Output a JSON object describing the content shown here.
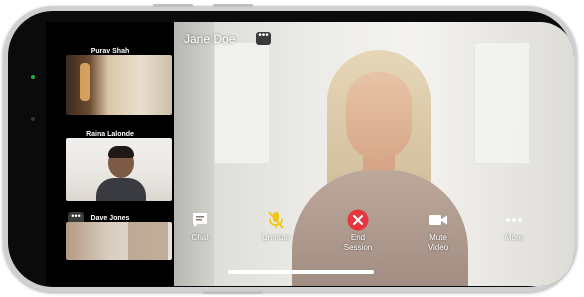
{
  "call": {
    "caller_name": "Jane Doe",
    "participants": [
      {
        "name": "Purav Shah"
      },
      {
        "name": "Raina Lalonde"
      },
      {
        "name": "Dave Jones"
      }
    ]
  },
  "controls": {
    "chat": "Chat",
    "unmute": "Unmute",
    "end_session": "End\nSession",
    "mute_video": "Mute\nVideo",
    "more": "More"
  },
  "glyphs": {
    "more_dots": "•••"
  },
  "colors": {
    "end_red": "#e8343d",
    "unmute_yellow": "#f1c40f",
    "status_green": "#2aa84a"
  },
  "icons": [
    "chat-icon",
    "microphone-muted-icon",
    "end-call-icon",
    "video-camera-icon",
    "more-icon"
  ]
}
